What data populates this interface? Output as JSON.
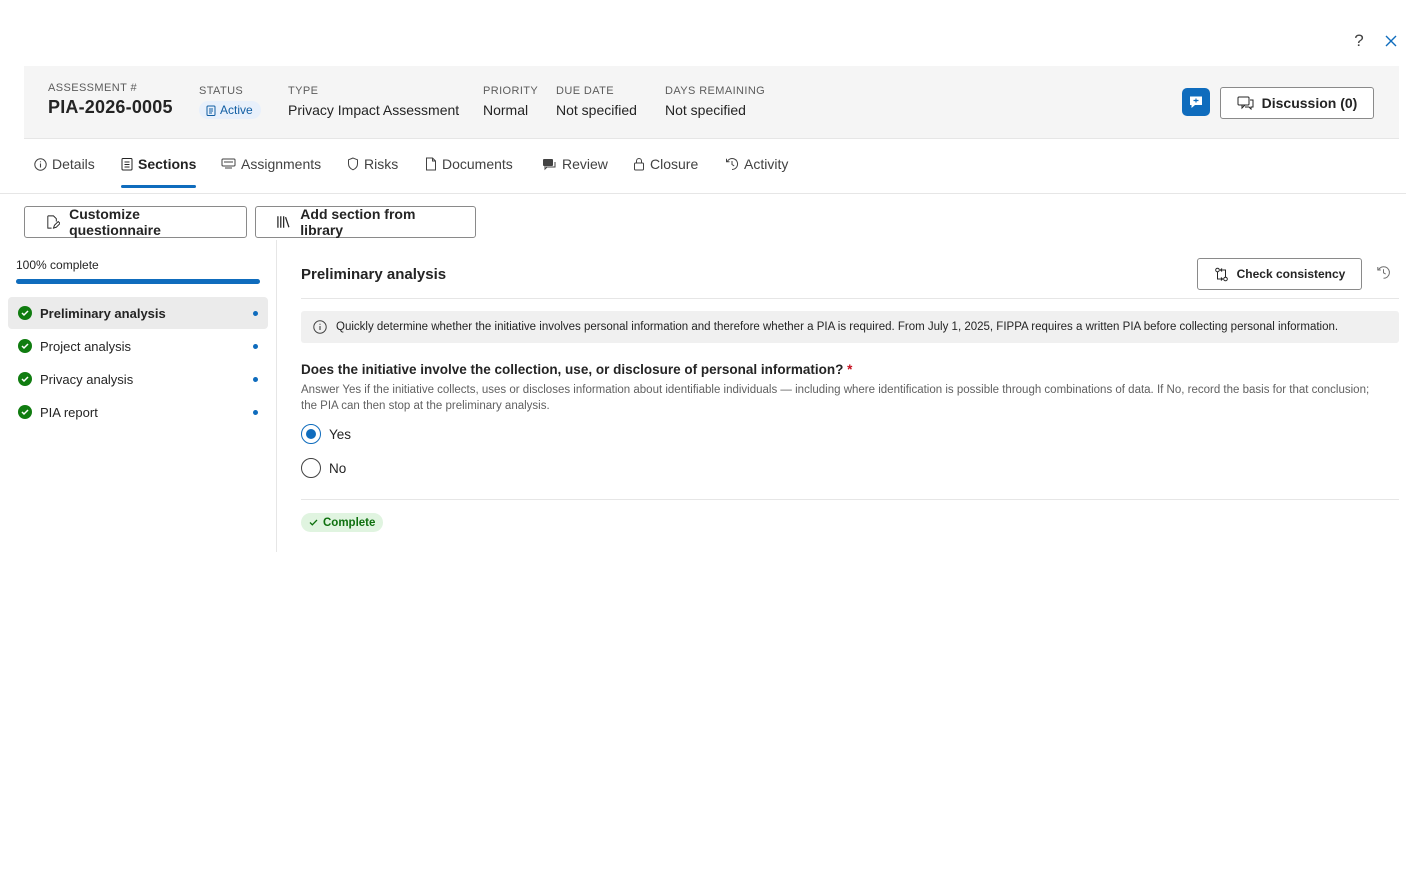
{
  "window": {
    "help_label": "?",
    "close_label": "Close"
  },
  "header": {
    "assessment": {
      "label": "ASSESSMENT #",
      "value": "PIA-2026-0005"
    },
    "status": {
      "label": "STATUS",
      "value": "Active"
    },
    "type": {
      "label": "TYPE",
      "value": "Privacy Impact Assessment"
    },
    "priority": {
      "label": "PRIORITY",
      "value": "Normal"
    },
    "due_date": {
      "label": "DUE DATE",
      "value": "Not specified"
    },
    "days_remaining": {
      "label": "DAYS REMAINING",
      "value": "Not specified"
    },
    "discussion_label": "Discussion (0)"
  },
  "tabs": [
    {
      "label": "Details",
      "icon": "info-icon"
    },
    {
      "label": "Sections",
      "icon": "clipboard-icon",
      "active": true
    },
    {
      "label": "Assignments",
      "icon": "assignments-icon"
    },
    {
      "label": "Risks",
      "icon": "shield-icon"
    },
    {
      "label": "Documents",
      "icon": "document-icon"
    },
    {
      "label": "Review",
      "icon": "review-icon"
    },
    {
      "label": "Closure",
      "icon": "lock-icon"
    },
    {
      "label": "Activity",
      "icon": "history-icon"
    }
  ],
  "toolbar": {
    "customize_label": "Customize questionnaire",
    "add_section_label": "Add section from library"
  },
  "sidebar": {
    "progress_label": "100% complete",
    "progress_value": 1.0,
    "items": [
      {
        "label": "Preliminary analysis",
        "active": true
      },
      {
        "label": "Project analysis"
      },
      {
        "label": "Privacy analysis"
      },
      {
        "label": "PIA report"
      }
    ]
  },
  "section": {
    "title": "Preliminary analysis",
    "check_consistency_label": "Check consistency",
    "info_text": "Quickly determine whether the initiative involves personal information and therefore whether a PIA is required. From July 1, 2025, FIPPA requires a written PIA before collecting personal information.",
    "question": {
      "label": "Does the initiative involve the collection, use, or disclosure of personal information?",
      "required_marker": "*",
      "help": "Answer Yes if the initiative collects, uses or discloses information about identifiable individuals — including where identification is possible through combinations of data. If No, record the basis for that conclusion; the PIA can then stop at the preliminary analysis.",
      "options": [
        "Yes",
        "No"
      ],
      "selected": "Yes"
    },
    "status_label": "Complete"
  },
  "colors": {
    "accent": "#0f6cbd",
    "success": "#107c10",
    "required": "#c50f1f"
  }
}
